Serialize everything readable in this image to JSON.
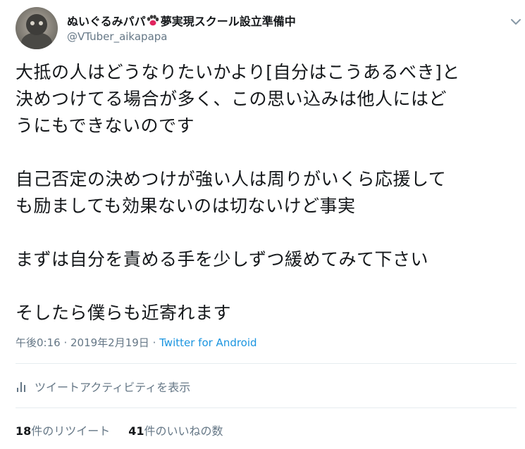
{
  "author": {
    "display_name": "ぬいぐるみパパ",
    "display_name_suffix": "夢実現スクール設立準備中",
    "handle": "@VTuber_aikapapa"
  },
  "tweet": {
    "lines": [
      "大抵の人はどうなりたいかより[自分はこうあるべき]と",
      "決めつけてる場合が多く、この思い込みは他人にはど",
      "うにもできないのです",
      "自己否定の決めつけが強い人は周りがいくら応援して",
      "も励ましても効果ないのは切ないけど事実",
      "まずは自分を責める手を少しずつ緩めてみて下さい",
      "そしたら僕らも近寄れます"
    ]
  },
  "meta": {
    "time": "午後0:16",
    "separator_1": " · ",
    "date": "2019年2月19日",
    "separator_2": " · ",
    "source": "Twitter for Android"
  },
  "activity": {
    "label": "ツイートアクティビティを表示",
    "icon": "activity-bars-icon"
  },
  "stats": {
    "retweets_count": "18",
    "retweets_label": "件のリツイート",
    "likes_count": "41",
    "likes_label": "件のいいねの数"
  },
  "colors": {
    "text": "#14171a",
    "secondary": "#657786",
    "link": "#1b95e0",
    "divider": "#e6ecf0",
    "paw": "#e0245e"
  }
}
